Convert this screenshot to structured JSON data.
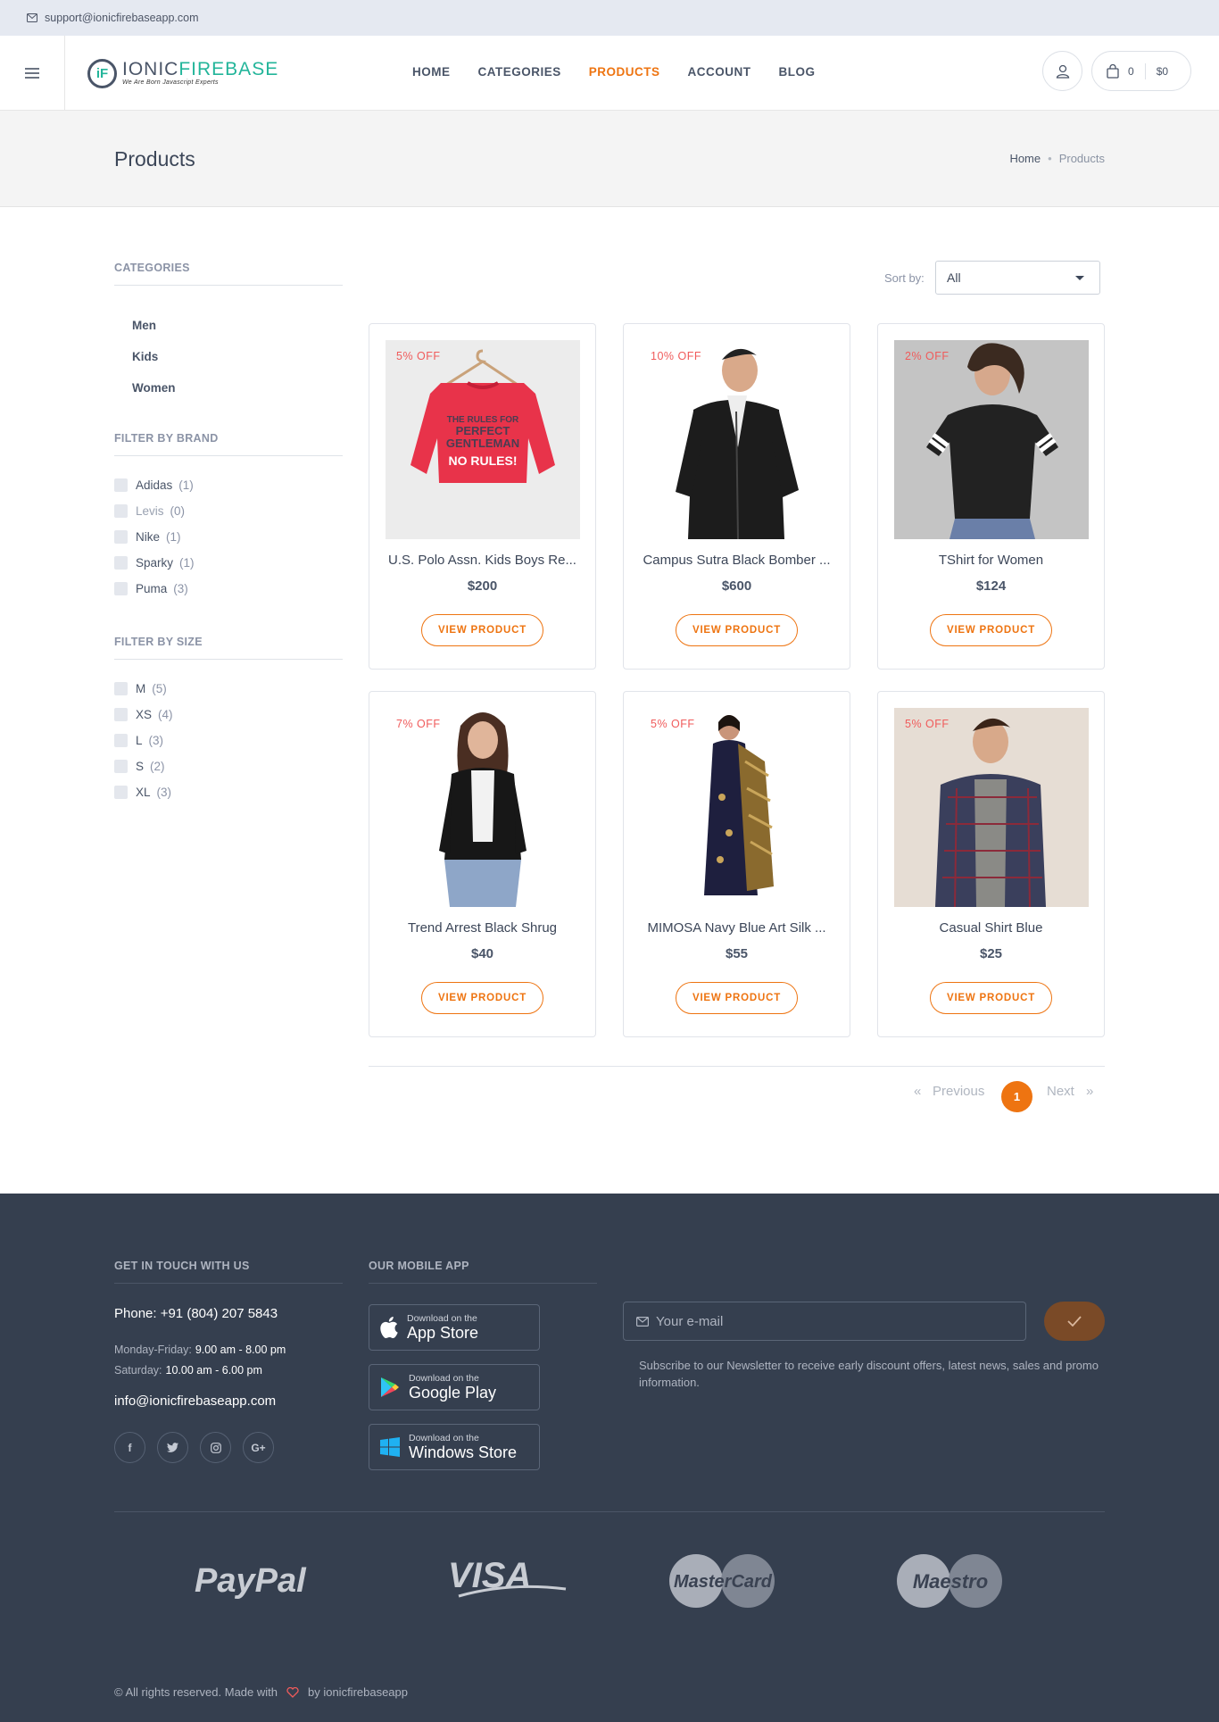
{
  "topbar": {
    "email": "support@ionicfirebaseapp.com"
  },
  "header": {
    "logo": {
      "part1": "IONIC",
      "part2": "FIREBASE",
      "tagline": "We Are Born Javascript Experts"
    },
    "nav": [
      "HOME",
      "CATEGORIES",
      "PRODUCTS",
      "ACCOUNT",
      "BLOG"
    ],
    "active_nav": "PRODUCTS",
    "cart": {
      "count": "0",
      "total": "$0"
    }
  },
  "page": {
    "title": "Products",
    "breadcrumb": {
      "home": "Home",
      "current": "Products"
    }
  },
  "sidebar": {
    "categories_title": "CATEGORIES",
    "categories": [
      "Men",
      "Kids",
      "Women"
    ],
    "brand_title": "FILTER BY BRAND",
    "brands": [
      {
        "name": "Adidas",
        "count": "(1)"
      },
      {
        "name": "Levis",
        "count": "(0)"
      },
      {
        "name": "Nike",
        "count": "(1)"
      },
      {
        "name": "Sparky",
        "count": "(1)"
      },
      {
        "name": "Puma",
        "count": "(3)"
      }
    ],
    "size_title": "FILTER BY SIZE",
    "sizes": [
      {
        "name": "M",
        "count": "(5)"
      },
      {
        "name": "XS",
        "count": "(4)"
      },
      {
        "name": "L",
        "count": "(3)"
      },
      {
        "name": "S",
        "count": "(2)"
      },
      {
        "name": "XL",
        "count": "(3)"
      }
    ]
  },
  "sort": {
    "label": "Sort by:",
    "value": "All"
  },
  "products": [
    {
      "discount": "5% OFF",
      "title": "U.S. Polo Assn. Kids Boys Re...",
      "price": "$200",
      "button": "VIEW PRODUCT",
      "image": "red-kids-sweatshirt"
    },
    {
      "discount": "10% OFF",
      "title": "Campus Sutra Black Bomber ...",
      "price": "$600",
      "button": "VIEW PRODUCT",
      "image": "man-black-bomber-jacket"
    },
    {
      "discount": "2% OFF",
      "title": "TShirt for Women",
      "price": "$124",
      "button": "VIEW PRODUCT",
      "image": "woman-black-tshirt"
    },
    {
      "discount": "7% OFF",
      "title": "Trend Arrest Black Shrug",
      "price": "$40",
      "button": "VIEW PRODUCT",
      "image": "woman-black-shrug"
    },
    {
      "discount": "5% OFF",
      "title": "MIMOSA Navy Blue Art Silk ...",
      "price": "$55",
      "button": "VIEW PRODUCT",
      "image": "woman-navy-saree"
    },
    {
      "discount": "5% OFF",
      "title": "Casual Shirt Blue",
      "price": "$25",
      "button": "VIEW PRODUCT",
      "image": "man-checked-shirt"
    }
  ],
  "pagination": {
    "prev": "Previous",
    "current": "1",
    "next": "Next",
    "prev_arrow": "«",
    "next_arrow": "»"
  },
  "footer": {
    "contact_title": "GET IN TOUCH WITH US",
    "phone": "Phone: +91 (804) 207 5843",
    "hours": [
      {
        "label": "Monday-Friday:",
        "value": "9.00 am - 8.00 pm"
      },
      {
        "label": "Saturday:",
        "value": "10.00 am - 6.00 pm"
      }
    ],
    "email": "info@ionicfirebaseapp.com",
    "social": [
      "f",
      "t",
      "ig",
      "G+"
    ],
    "app_title": "OUR MOBILE APP",
    "stores": [
      {
        "small": "Download on the",
        "big": "App Store",
        "icon": "apple-icon"
      },
      {
        "small": "Download on the",
        "big": "Google Play",
        "icon": "google-play-icon"
      },
      {
        "small": "Download on the",
        "big": "Windows Store",
        "icon": "windows-icon"
      }
    ],
    "newsletter_placeholder": "Your e-mail",
    "newsletter_text": "Subscribe to our Newsletter to receive early discount offers, latest news, sales and promo information.",
    "payments": [
      "PayPal",
      "VISA",
      "MasterCard",
      "Maestro"
    ],
    "copyright_pre": "© All rights reserved. Made with",
    "copyright_post": "by ionicfirebaseapp"
  },
  "colors": {
    "accent": "#ee7411",
    "discount": "#f05b5b",
    "footer": "#353f4f"
  }
}
